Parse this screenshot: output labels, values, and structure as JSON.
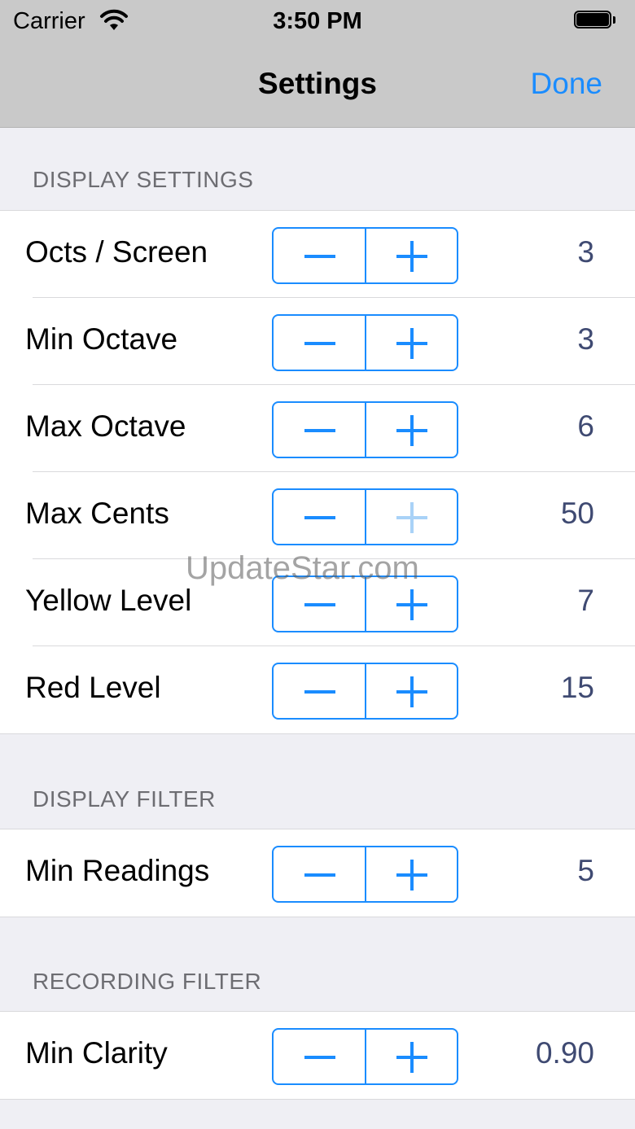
{
  "status_bar": {
    "carrier": "Carrier",
    "time": "3:50 PM"
  },
  "nav": {
    "title": "Settings",
    "done_label": "Done"
  },
  "sections": [
    {
      "header": "DISPLAY SETTINGS",
      "rows": [
        {
          "label": "Octs / Screen",
          "value": "3"
        },
        {
          "label": "Min Octave",
          "value": "3"
        },
        {
          "label": "Max Octave",
          "value": "6"
        },
        {
          "label": "Max Cents",
          "value": "50",
          "plus_disabled": true
        },
        {
          "label": "Yellow Level",
          "value": "7"
        },
        {
          "label": "Red Level",
          "value": "15"
        }
      ]
    },
    {
      "header": "DISPLAY FILTER",
      "rows": [
        {
          "label": "Min Readings",
          "value": "5"
        }
      ]
    },
    {
      "header": "RECORDING FILTER",
      "rows": [
        {
          "label": "Min Clarity",
          "value": "0.90"
        }
      ]
    }
  ],
  "icons": {
    "wifi": "wifi-icon",
    "battery": "battery-icon",
    "minus": "minus-icon",
    "plus": "plus-icon"
  },
  "colors": {
    "accent": "#1a8cff",
    "value_text": "#3f4a72",
    "nav_bg": "#c9c9c9",
    "page_bg": "#efeff4"
  },
  "watermark": "UpdateStar.com"
}
